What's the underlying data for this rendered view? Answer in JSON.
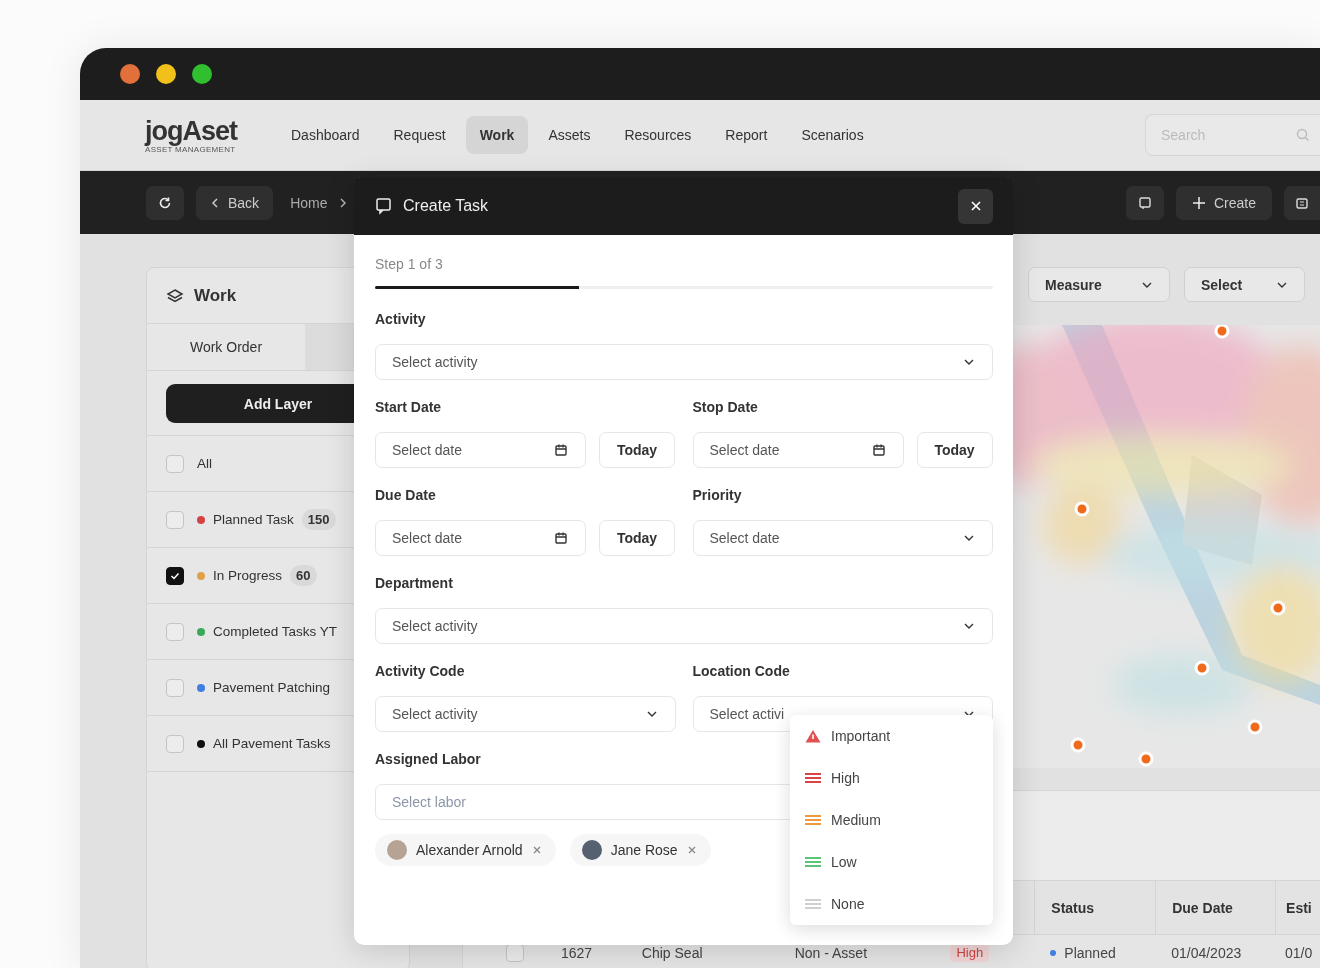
{
  "window": {
    "traffic_lights": [
      {
        "color": "#e2703a"
      },
      {
        "color": "#f2c01a"
      },
      {
        "color": "#2fbf2f"
      }
    ]
  },
  "app": {
    "logo": "jogAset",
    "logo_subtitle": "ASSET MANAGEMENT"
  },
  "nav": [
    {
      "label": "Dashboard",
      "selected": false
    },
    {
      "label": "Request",
      "selected": false
    },
    {
      "label": "Work",
      "selected": true
    },
    {
      "label": "Assets",
      "selected": false
    },
    {
      "label": "Resources",
      "selected": false
    },
    {
      "label": "Report",
      "selected": false
    },
    {
      "label": "Scenarios",
      "selected": false
    }
  ],
  "search": {
    "placeholder": "Search"
  },
  "toolbar": {
    "back": "Back",
    "breadcrumb": "Home",
    "create": "Create"
  },
  "sidebar": {
    "title": "Work",
    "tabs": [
      {
        "label": "Work Order",
        "selected": true
      }
    ],
    "add_button": "Add Layer",
    "layers": [
      {
        "label": "All",
        "checked": false
      },
      {
        "label": "Planned Task",
        "color": "#d44343",
        "count": "150",
        "checked": false
      },
      {
        "label": "In Progress",
        "color": "#e3a04a",
        "count": "60",
        "checked": true
      },
      {
        "label": "Completed Tasks YT",
        "color": "#3aa85a",
        "checked": false
      },
      {
        "label": "Pavement Patching",
        "color": "#3f7fe0",
        "checked": false
      },
      {
        "label": "All Pavement Tasks",
        "color": "#111111",
        "checked": false
      }
    ]
  },
  "map_controls": [
    {
      "label": "Measure"
    },
    {
      "label": "Select"
    }
  ],
  "table": {
    "columns": [
      "Status",
      "Due Date",
      "Esti"
    ],
    "rows": [
      {
        "checked": false,
        "id": "1627",
        "activity": "Chip Seal",
        "asset": "Non - Asset",
        "priority": "High",
        "status": {
          "label": "Planned",
          "color": "#3f7fe0"
        },
        "due_date": "01/04/2023",
        "column_8": "01/0"
      }
    ]
  },
  "modal": {
    "title": "Create Task",
    "step": "Step 1 of 3",
    "progress": {
      "level": 0.33
    },
    "rows": [
      [
        {
          "label": "Activity",
          "kind": "select",
          "placeholder": "Select activity"
        }
      ],
      [
        {
          "label": "Start Date",
          "kind": "date",
          "placeholder": "Select date",
          "button": "Today"
        },
        {
          "label": "Stop Date",
          "kind": "date",
          "placeholder": "Select date",
          "button": "Today"
        }
      ],
      [
        {
          "label": "Due Date",
          "kind": "date",
          "placeholder": "Select date",
          "button": "Today"
        },
        {
          "label": "Priority",
          "kind": "select",
          "placeholder": "Select date"
        }
      ],
      [
        {
          "label": "Department",
          "kind": "select",
          "placeholder": "Select activity"
        }
      ],
      [
        {
          "label": "Activity Code",
          "kind": "select",
          "placeholder": "Select activity"
        },
        {
          "label": "Location Code",
          "kind": "select",
          "placeholder": "Select activi"
        }
      ],
      [
        {
          "label": "Assigned Labor",
          "kind": "text",
          "placeholder": "Select labor",
          "chips": [
            {
              "name": "Alexander Arnold"
            },
            {
              "name": "Jane Rose"
            }
          ]
        }
      ]
    ]
  },
  "priority_menu": [
    {
      "label": "Important",
      "kind": "warning",
      "color": "#e05252"
    },
    {
      "label": "High",
      "kind": "lines",
      "color": "#d94545"
    },
    {
      "label": "Medium",
      "kind": "lines",
      "color": "#ef9a3c"
    },
    {
      "label": "Low",
      "kind": "lines",
      "color": "#5cc47a"
    },
    {
      "label": "None",
      "kind": "lines",
      "color": "#cfcfcf"
    }
  ]
}
